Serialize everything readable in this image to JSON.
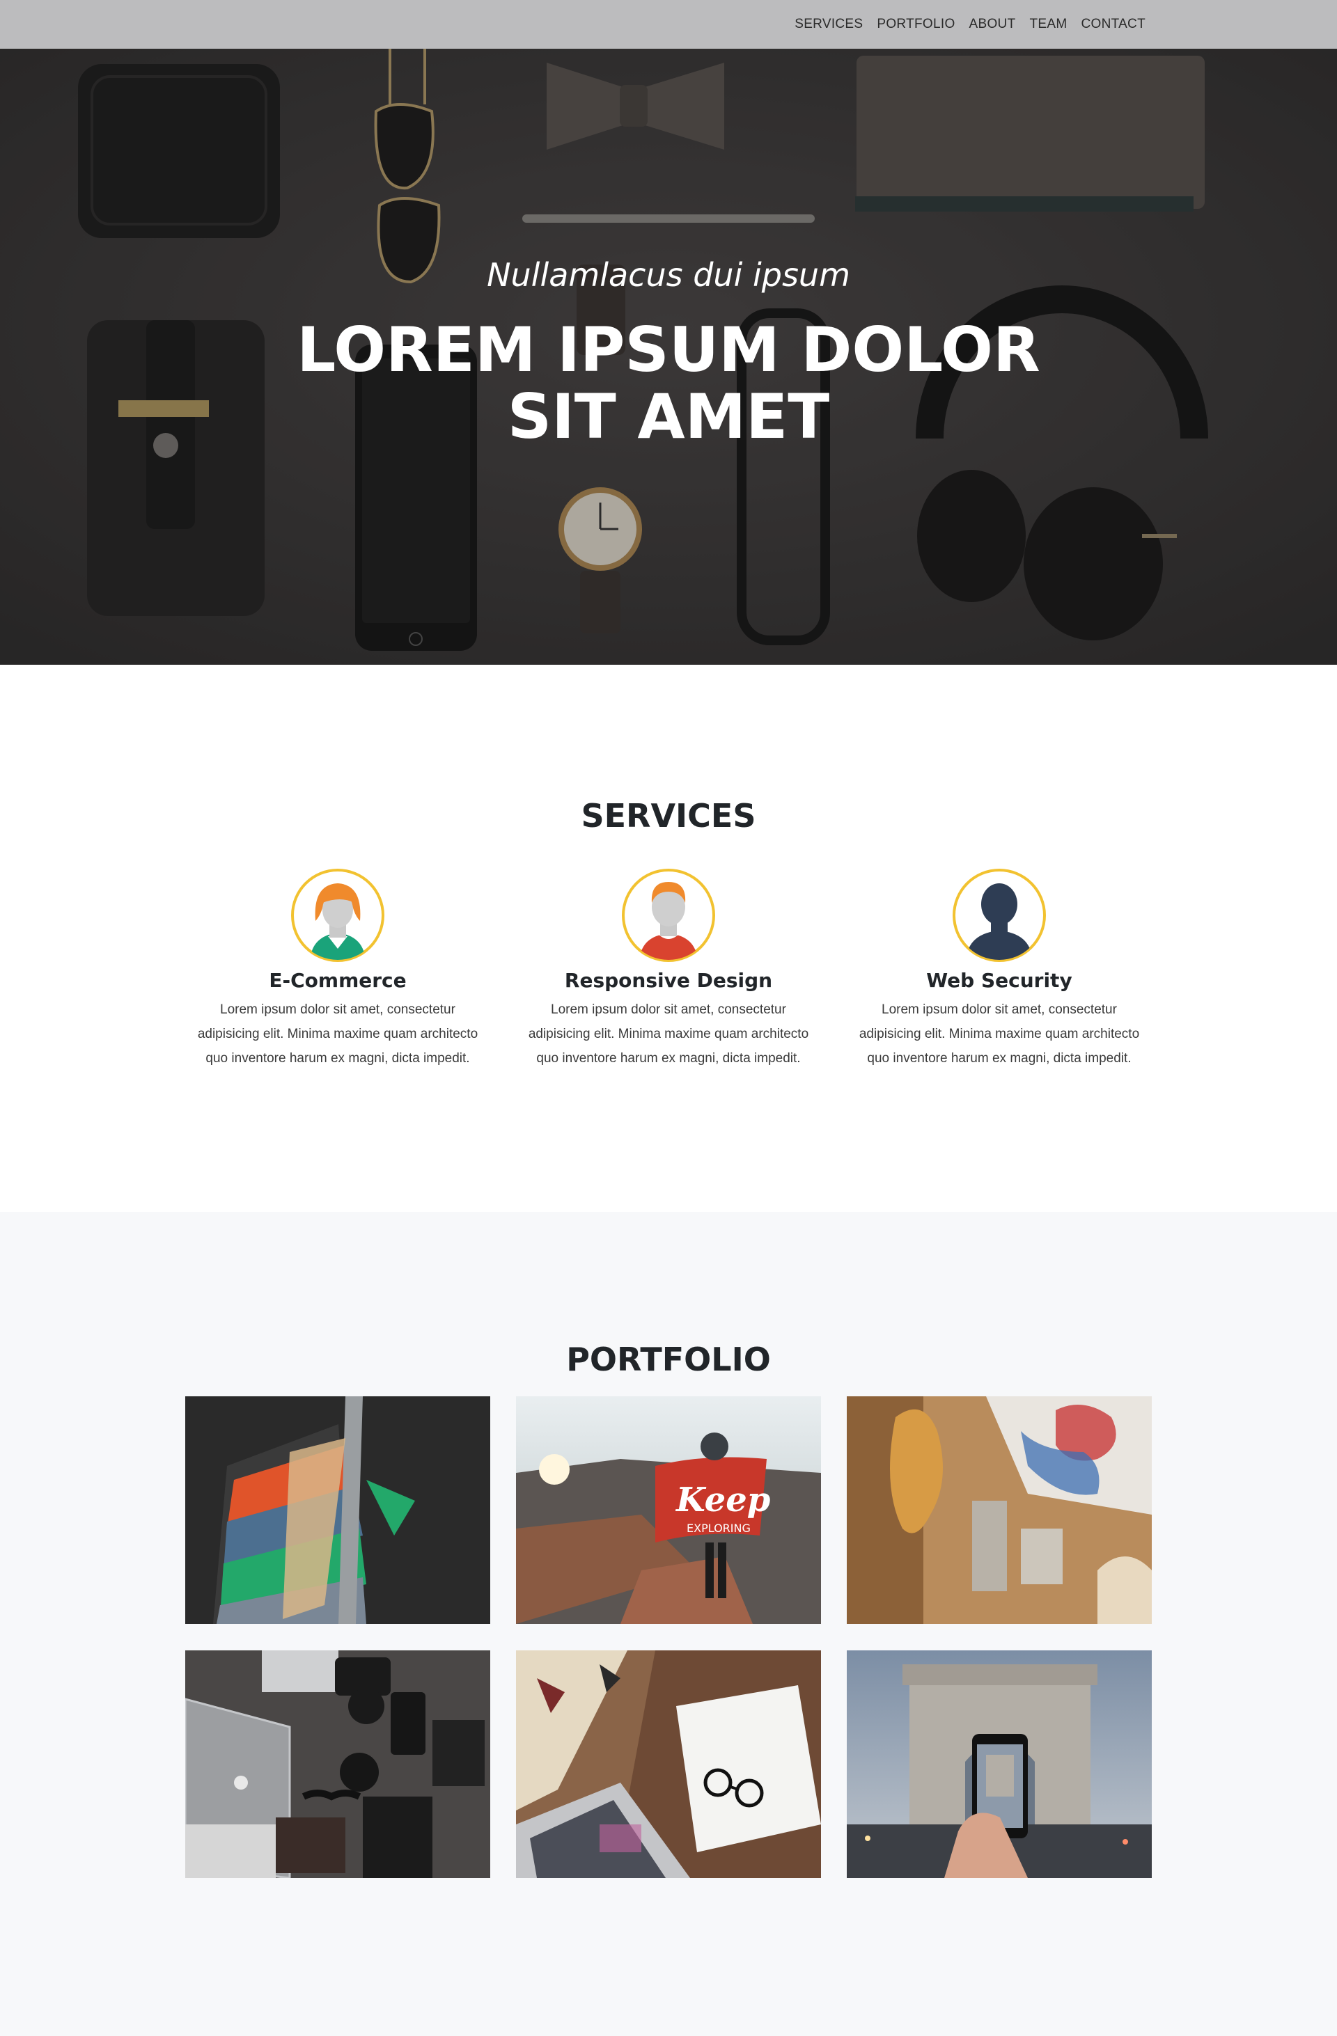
{
  "nav": {
    "links": [
      "SERVICES",
      "PORTFOLIO",
      "ABOUT",
      "TEAM",
      "CONTACT"
    ]
  },
  "hero": {
    "subtitle": "Nullamlacus dui ipsum",
    "title": "LOREM IPSUM DOLOR SIT AMET"
  },
  "services": {
    "heading": "SERVICES",
    "items": [
      {
        "name": "E-Commerce",
        "text": "Lorem ipsum dolor sit amet, consectetur adipisicing elit. Minima maxime quam architecto quo inventore harum ex magni, dicta impedit.",
        "icon": "woman-avatar-icon"
      },
      {
        "name": "Responsive Design",
        "text": "Lorem ipsum dolor sit amet, consectetur adipisicing elit. Minima maxime quam architecto quo inventore harum ex magni, dicta impedit.",
        "icon": "man-avatar-icon"
      },
      {
        "name": "Web Security",
        "text": "Lorem ipsum dolor sit amet, consectetur adipisicing elit. Minima maxime quam architecto quo inventore harum ex magni, dicta impedit.",
        "icon": "silhouette-avatar-icon"
      }
    ]
  },
  "portfolio": {
    "heading": "PORTFOLIO",
    "items": [
      {
        "subject": "clothes-rack-photo"
      },
      {
        "subject": "keep-exploring-flag-photo",
        "flag_text_1": "Keep",
        "flag_text_2": "EXPLORING"
      },
      {
        "subject": "guitar-workshop-photo"
      },
      {
        "subject": "laptop-camera-desk-photo"
      },
      {
        "subject": "laptop-notebook-glasses-photo"
      },
      {
        "subject": "arc-de-triomphe-phone-photo"
      }
    ]
  },
  "colors": {
    "navbar": "#bcbcbe",
    "hero_bg": "#3a3838",
    "avatar_ring": "#f2c230",
    "portfolio_bg": "#f7f8fa"
  }
}
